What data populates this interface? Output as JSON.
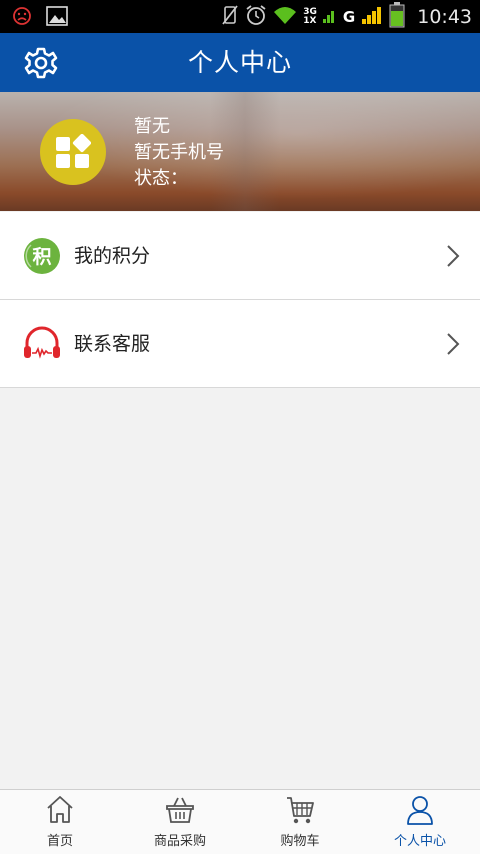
{
  "status_bar": {
    "time": "10:43",
    "network_top": "3G",
    "network_bottom": "1X",
    "carrier_letter": "G"
  },
  "header": {
    "title": "个人中心",
    "settings_icon": "gear-icon"
  },
  "profile": {
    "name": "暂无",
    "phone": "暂无手机号",
    "status_label": "状态：",
    "avatar_icon": "apps-icon"
  },
  "menu": [
    {
      "label": "我的积分",
      "icon": "points-icon",
      "icon_text": "积",
      "icon_color": "#6cb33e"
    },
    {
      "label": "联系客服",
      "icon": "headset-icon",
      "icon_color": "#e0262c"
    }
  ],
  "tabs": [
    {
      "label": "首页",
      "icon": "home-icon",
      "active": false
    },
    {
      "label": "商品采购",
      "icon": "basket-icon",
      "active": false
    },
    {
      "label": "购物车",
      "icon": "cart-icon",
      "active": false
    },
    {
      "label": "个人中心",
      "icon": "user-icon",
      "active": true
    }
  ],
  "colors": {
    "primary": "#0a52a8",
    "avatar_bg": "#d9c21f",
    "background": "#f2f2f2"
  }
}
